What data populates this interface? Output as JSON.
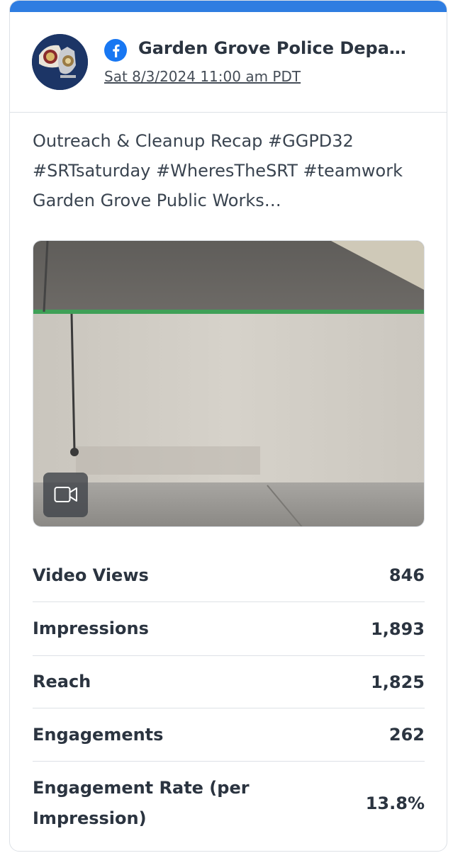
{
  "post": {
    "account_name": "Garden Grove Police Depa…",
    "date": "Sat 8/3/2024 11:00 am PDT",
    "caption": "Outreach & Cleanup Recap #GGPD32 #SRTsaturday #WheresTheSRT #teamwork Garden Grove Public Works…",
    "platform_icon": "facebook-icon",
    "media_type_icon": "video-camera-icon"
  },
  "metrics": [
    {
      "label": "Video Views",
      "value": "846"
    },
    {
      "label": "Impressions",
      "value": "1,893"
    },
    {
      "label": "Reach",
      "value": "1,825"
    },
    {
      "label": "Engagements",
      "value": "262"
    },
    {
      "label": "Engagement Rate (per Impression)",
      "value": "13.8%"
    }
  ],
  "colors": {
    "accent": "#2f7de1",
    "facebook": "#1877f2",
    "text": "#2b3440",
    "divider": "#dde1e6"
  }
}
